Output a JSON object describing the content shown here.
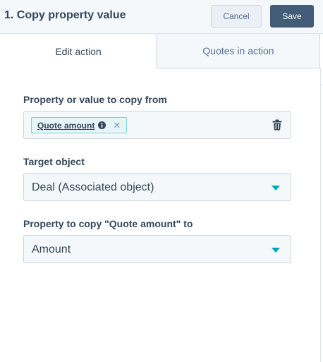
{
  "header": {
    "title": "1. Copy property value",
    "cancel_label": "Cancel",
    "save_label": "Save"
  },
  "tabs": [
    {
      "label": "Edit action",
      "active": true
    },
    {
      "label": "Quotes in action",
      "active": false
    }
  ],
  "form": {
    "source": {
      "label": "Property or value to copy from",
      "token": "Quote amount",
      "token_icon": "info-icon",
      "remove_icon": "close-icon",
      "delete_icon": "trash-icon"
    },
    "target_object": {
      "label": "Target object",
      "value": "Deal (Associated object)"
    },
    "target_property": {
      "label": "Property to copy \"Quote amount\" to",
      "value": "Amount"
    }
  },
  "colors": {
    "accent": "#00a4bd",
    "primary_button": "#425b76",
    "text": "#33475b"
  }
}
